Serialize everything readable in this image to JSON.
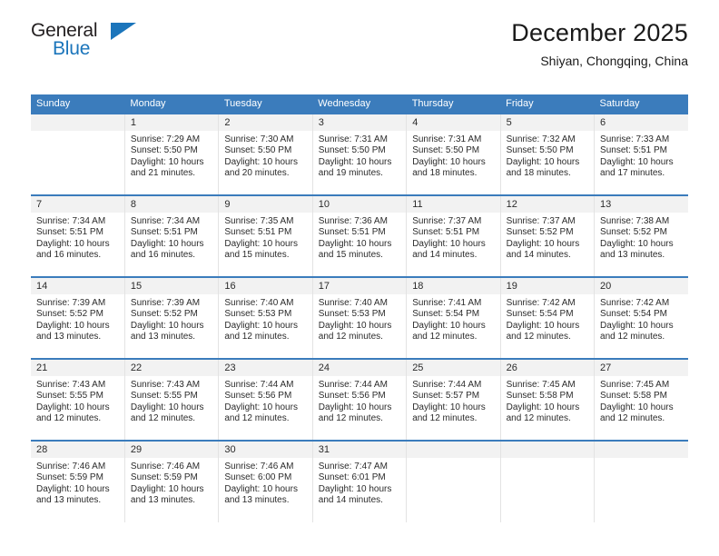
{
  "brand": {
    "name_top": "General",
    "name_bottom": "Blue",
    "color_blue": "#1b75bb",
    "color_dark": "#231f20",
    "triangle_icon": "triangle-icon"
  },
  "header": {
    "title": "December 2025",
    "subtitle": "Shiyan, Chongqing, China"
  },
  "theme": {
    "header_blue": "#3b7cbc",
    "daynum_band": "#f2f2f2",
    "text": "#2b2b2b"
  },
  "weekdays": [
    "Sunday",
    "Monday",
    "Tuesday",
    "Wednesday",
    "Thursday",
    "Friday",
    "Saturday"
  ],
  "weeks": [
    [
      {
        "day": ""
      },
      {
        "day": "1",
        "sunrise": "Sunrise: 7:29 AM",
        "sunset": "Sunset: 5:50 PM",
        "daylight": "Daylight: 10 hours and 21 minutes."
      },
      {
        "day": "2",
        "sunrise": "Sunrise: 7:30 AM",
        "sunset": "Sunset: 5:50 PM",
        "daylight": "Daylight: 10 hours and 20 minutes."
      },
      {
        "day": "3",
        "sunrise": "Sunrise: 7:31 AM",
        "sunset": "Sunset: 5:50 PM",
        "daylight": "Daylight: 10 hours and 19 minutes."
      },
      {
        "day": "4",
        "sunrise": "Sunrise: 7:31 AM",
        "sunset": "Sunset: 5:50 PM",
        "daylight": "Daylight: 10 hours and 18 minutes."
      },
      {
        "day": "5",
        "sunrise": "Sunrise: 7:32 AM",
        "sunset": "Sunset: 5:50 PM",
        "daylight": "Daylight: 10 hours and 18 minutes."
      },
      {
        "day": "6",
        "sunrise": "Sunrise: 7:33 AM",
        "sunset": "Sunset: 5:51 PM",
        "daylight": "Daylight: 10 hours and 17 minutes."
      }
    ],
    [
      {
        "day": "7",
        "sunrise": "Sunrise: 7:34 AM",
        "sunset": "Sunset: 5:51 PM",
        "daylight": "Daylight: 10 hours and 16 minutes."
      },
      {
        "day": "8",
        "sunrise": "Sunrise: 7:34 AM",
        "sunset": "Sunset: 5:51 PM",
        "daylight": "Daylight: 10 hours and 16 minutes."
      },
      {
        "day": "9",
        "sunrise": "Sunrise: 7:35 AM",
        "sunset": "Sunset: 5:51 PM",
        "daylight": "Daylight: 10 hours and 15 minutes."
      },
      {
        "day": "10",
        "sunrise": "Sunrise: 7:36 AM",
        "sunset": "Sunset: 5:51 PM",
        "daylight": "Daylight: 10 hours and 15 minutes."
      },
      {
        "day": "11",
        "sunrise": "Sunrise: 7:37 AM",
        "sunset": "Sunset: 5:51 PM",
        "daylight": "Daylight: 10 hours and 14 minutes."
      },
      {
        "day": "12",
        "sunrise": "Sunrise: 7:37 AM",
        "sunset": "Sunset: 5:52 PM",
        "daylight": "Daylight: 10 hours and 14 minutes."
      },
      {
        "day": "13",
        "sunrise": "Sunrise: 7:38 AM",
        "sunset": "Sunset: 5:52 PM",
        "daylight": "Daylight: 10 hours and 13 minutes."
      }
    ],
    [
      {
        "day": "14",
        "sunrise": "Sunrise: 7:39 AM",
        "sunset": "Sunset: 5:52 PM",
        "daylight": "Daylight: 10 hours and 13 minutes."
      },
      {
        "day": "15",
        "sunrise": "Sunrise: 7:39 AM",
        "sunset": "Sunset: 5:52 PM",
        "daylight": "Daylight: 10 hours and 13 minutes."
      },
      {
        "day": "16",
        "sunrise": "Sunrise: 7:40 AM",
        "sunset": "Sunset: 5:53 PM",
        "daylight": "Daylight: 10 hours and 12 minutes."
      },
      {
        "day": "17",
        "sunrise": "Sunrise: 7:40 AM",
        "sunset": "Sunset: 5:53 PM",
        "daylight": "Daylight: 10 hours and 12 minutes."
      },
      {
        "day": "18",
        "sunrise": "Sunrise: 7:41 AM",
        "sunset": "Sunset: 5:54 PM",
        "daylight": "Daylight: 10 hours and 12 minutes."
      },
      {
        "day": "19",
        "sunrise": "Sunrise: 7:42 AM",
        "sunset": "Sunset: 5:54 PM",
        "daylight": "Daylight: 10 hours and 12 minutes."
      },
      {
        "day": "20",
        "sunrise": "Sunrise: 7:42 AM",
        "sunset": "Sunset: 5:54 PM",
        "daylight": "Daylight: 10 hours and 12 minutes."
      }
    ],
    [
      {
        "day": "21",
        "sunrise": "Sunrise: 7:43 AM",
        "sunset": "Sunset: 5:55 PM",
        "daylight": "Daylight: 10 hours and 12 minutes."
      },
      {
        "day": "22",
        "sunrise": "Sunrise: 7:43 AM",
        "sunset": "Sunset: 5:55 PM",
        "daylight": "Daylight: 10 hours and 12 minutes."
      },
      {
        "day": "23",
        "sunrise": "Sunrise: 7:44 AM",
        "sunset": "Sunset: 5:56 PM",
        "daylight": "Daylight: 10 hours and 12 minutes."
      },
      {
        "day": "24",
        "sunrise": "Sunrise: 7:44 AM",
        "sunset": "Sunset: 5:56 PM",
        "daylight": "Daylight: 10 hours and 12 minutes."
      },
      {
        "day": "25",
        "sunrise": "Sunrise: 7:44 AM",
        "sunset": "Sunset: 5:57 PM",
        "daylight": "Daylight: 10 hours and 12 minutes."
      },
      {
        "day": "26",
        "sunrise": "Sunrise: 7:45 AM",
        "sunset": "Sunset: 5:58 PM",
        "daylight": "Daylight: 10 hours and 12 minutes."
      },
      {
        "day": "27",
        "sunrise": "Sunrise: 7:45 AM",
        "sunset": "Sunset: 5:58 PM",
        "daylight": "Daylight: 10 hours and 12 minutes."
      }
    ],
    [
      {
        "day": "28",
        "sunrise": "Sunrise: 7:46 AM",
        "sunset": "Sunset: 5:59 PM",
        "daylight": "Daylight: 10 hours and 13 minutes."
      },
      {
        "day": "29",
        "sunrise": "Sunrise: 7:46 AM",
        "sunset": "Sunset: 5:59 PM",
        "daylight": "Daylight: 10 hours and 13 minutes."
      },
      {
        "day": "30",
        "sunrise": "Sunrise: 7:46 AM",
        "sunset": "Sunset: 6:00 PM",
        "daylight": "Daylight: 10 hours and 13 minutes."
      },
      {
        "day": "31",
        "sunrise": "Sunrise: 7:47 AM",
        "sunset": "Sunset: 6:01 PM",
        "daylight": "Daylight: 10 hours and 14 minutes."
      },
      {
        "day": ""
      },
      {
        "day": ""
      },
      {
        "day": ""
      }
    ]
  ]
}
